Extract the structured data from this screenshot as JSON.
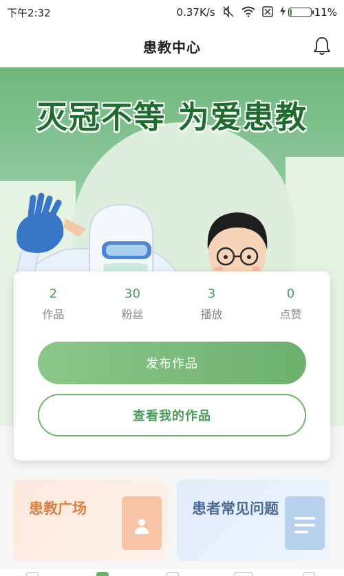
{
  "status_bar": {
    "time": "下午2:32",
    "network_speed": "0.37K/s",
    "battery_percent": "11%",
    "battery_level": 0.11,
    "icons": [
      "mute-icon",
      "wifi-icon",
      "sim-off-icon",
      "charging-icon",
      "battery-icon"
    ]
  },
  "navbar": {
    "title": "患教中心",
    "bell_icon": "bell-icon"
  },
  "hero": {
    "slogan": "灭冠不等 为爱患教"
  },
  "stats": [
    {
      "value": "2",
      "label": "作品"
    },
    {
      "value": "30",
      "label": "粉丝"
    },
    {
      "value": "3",
      "label": "播放"
    },
    {
      "value": "0",
      "label": "点赞"
    }
  ],
  "actions": {
    "publish": "发布作品",
    "view_mine": "查看我的作品"
  },
  "tiles": {
    "square": "患教广场",
    "faq": "患者常见问题"
  },
  "colors": {
    "brand_green": "#6db06c",
    "accent_orange": "#d8803f",
    "accent_blue": "#4a6a95"
  }
}
